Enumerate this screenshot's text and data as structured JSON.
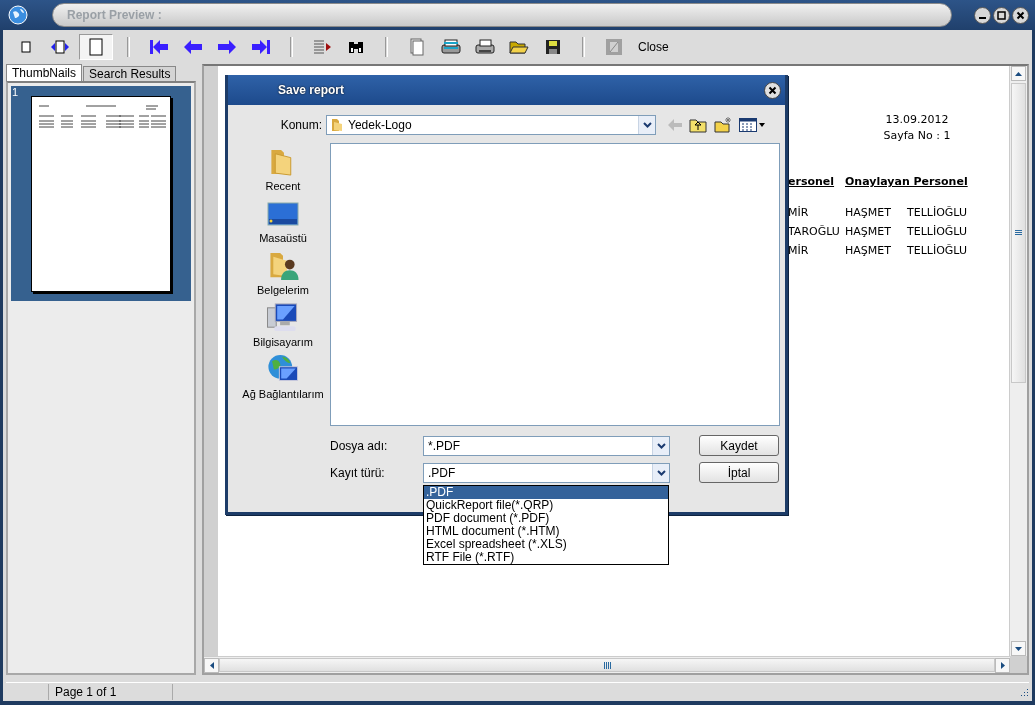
{
  "window": {
    "title": "Report Preview :"
  },
  "toolbar": {
    "zoom_buttons": [
      {
        "selected": false
      },
      {
        "selected": false
      },
      {
        "selected": true
      }
    ],
    "close_label": "Close"
  },
  "tabs": [
    {
      "label": "ThumbNails",
      "selected": true
    },
    {
      "label": "Search Results",
      "selected": false
    }
  ],
  "thumbnails": [
    {
      "label": "1",
      "selected": true
    }
  ],
  "report": {
    "date": "13.09.2012",
    "page_no": "Sayfa No :  1",
    "headers": [
      "ersonel",
      "Onaylayan Personel"
    ],
    "rows": [
      [
        "MİR",
        "HAŞMET",
        "TELLİOĞLU"
      ],
      [
        "TAROĞLU",
        "HAŞMET",
        "TELLİOĞLU"
      ],
      [
        "MİR",
        "HAŞMET",
        "TELLİOĞLU"
      ]
    ]
  },
  "status_bar": {
    "page": "Page 1 of 1"
  },
  "dialog": {
    "title": "Save report",
    "location_label": "Konum:",
    "location": "Yedek-Logo",
    "places": [
      {
        "kind": "recent",
        "label": "Recent"
      },
      {
        "kind": "desktop",
        "label": "Masaüstü"
      },
      {
        "kind": "documents",
        "label": "Belgelerim"
      },
      {
        "kind": "computer",
        "label": "Bilgisayarım"
      },
      {
        "kind": "network",
        "label": "Ağ Bağlantılarım"
      }
    ],
    "filename_label": "Dosya adı:",
    "filename": "*.PDF",
    "type_label": "Kayıt türü:",
    "type": ".PDF",
    "buttons": [
      "Kaydet",
      "İptal"
    ],
    "type_options": [
      {
        "label": ".PDF",
        "selected": true
      },
      {
        "label": "QuickReport file(*.QRP)",
        "selected": false
      },
      {
        "label": "PDF document (*.PDF)",
        "selected": false
      },
      {
        "label": "HTML document (*.HTM)",
        "selected": false
      },
      {
        "label": "Excel spreadsheet (*.XLS)",
        "selected": false
      },
      {
        "label": "RTF File (*.RTF)",
        "selected": false
      }
    ]
  }
}
